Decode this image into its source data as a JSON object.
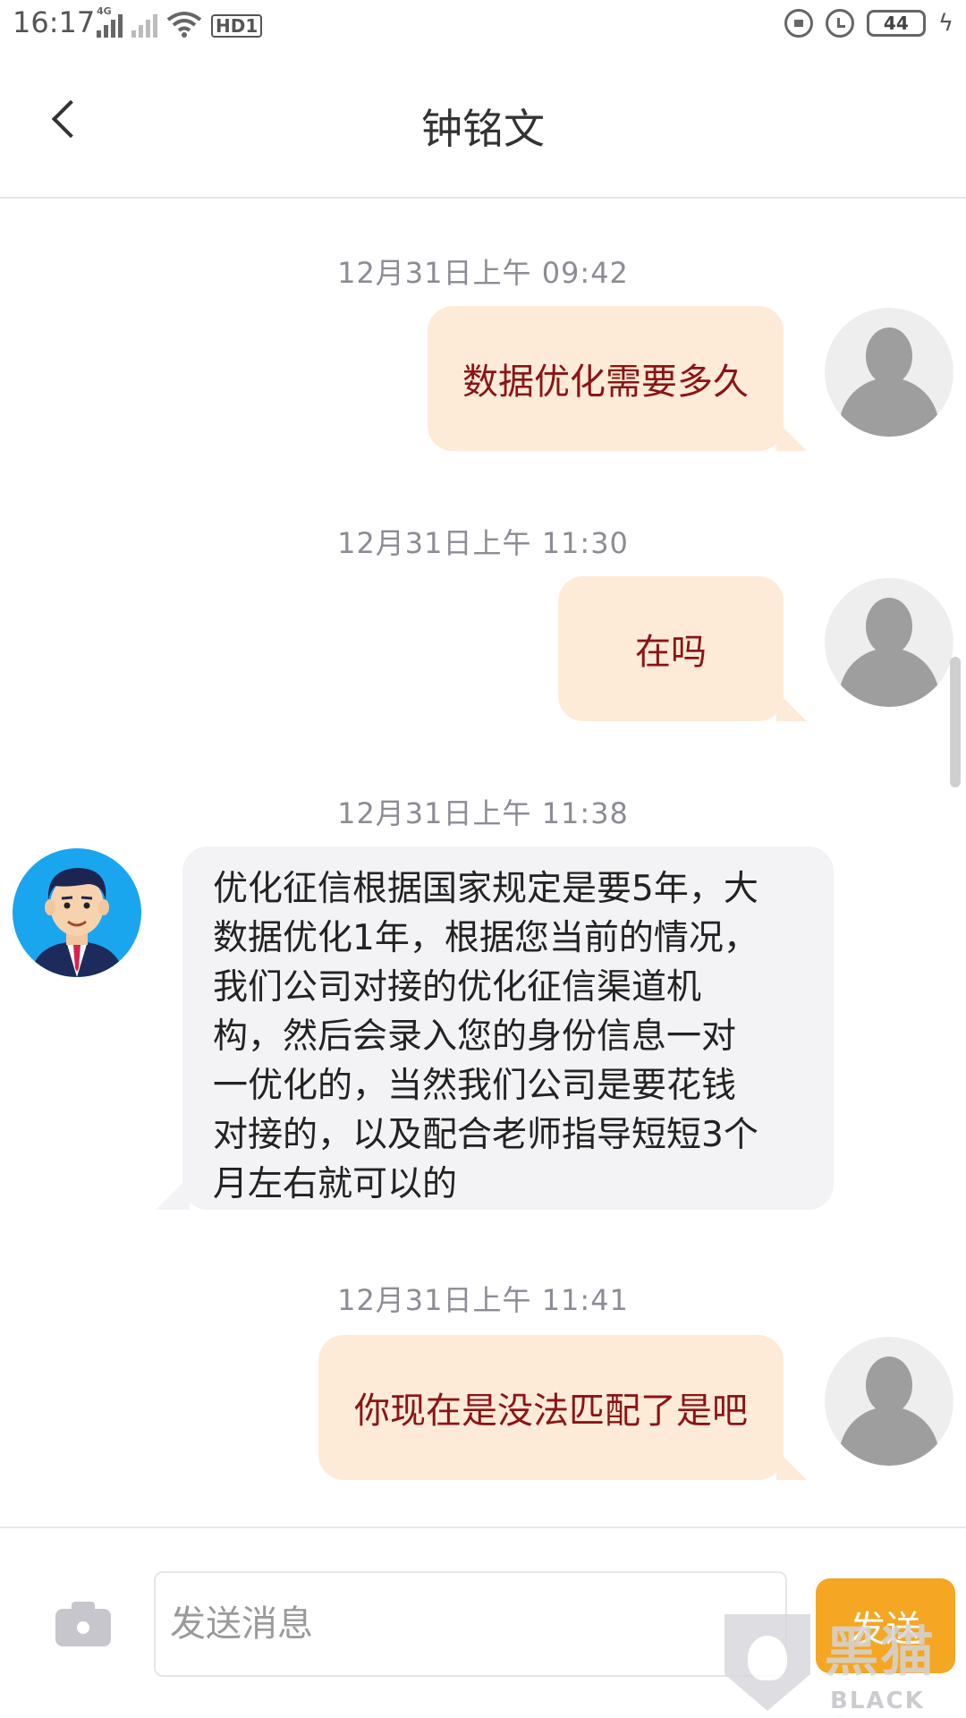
{
  "status_bar": {
    "time": "16:17",
    "network_type": "4G",
    "connection_badge": "HD1",
    "battery_level": "44",
    "icons": [
      "signal-icon",
      "signal-no-sim-icon",
      "wifi-icon",
      "hd-icon",
      "lock-rotation-icon",
      "alarm-icon",
      "battery-icon",
      "charging-icon"
    ]
  },
  "header": {
    "title": "钟铭文",
    "back_icon": "chevron-left-icon"
  },
  "messages": [
    {
      "timestamp": "12月31日上午  09:42",
      "sender": "me",
      "text": "数据优化需要多久"
    },
    {
      "timestamp": "12月31日上午  11:30",
      "sender": "me",
      "text": "在吗"
    },
    {
      "timestamp": "12月31日上午  11:38",
      "sender": "agent",
      "lines": [
        "优化征信根据国家规定是要5年，大",
        "数据优化1年，根据您当前的情况，",
        "我们公司对接的优化征信渠道机",
        "构，然后会录入您的身份信息一对",
        "一优化的，当然我们公司是要花钱",
        "对接的，以及配合老师指导短短3个",
        "月左右就可以的"
      ]
    },
    {
      "timestamp": "12月31日上午  11:41",
      "sender": "me",
      "text": "你现在是没法匹配了是吧"
    }
  ],
  "input_bar": {
    "camera_icon": "camera-icon",
    "placeholder": "发送消息",
    "send_label": "发送"
  },
  "watermark": {
    "logo_text": "黑猫",
    "brand_text": "BLACK CAT"
  },
  "colors": {
    "outgoing_bubble": "#fdebd8",
    "outgoing_text": "#8b1414",
    "incoming_bubble": "#f3f3f5",
    "send_button": "#f5a622",
    "agent_avatar_bg": "#1aa6ee"
  }
}
